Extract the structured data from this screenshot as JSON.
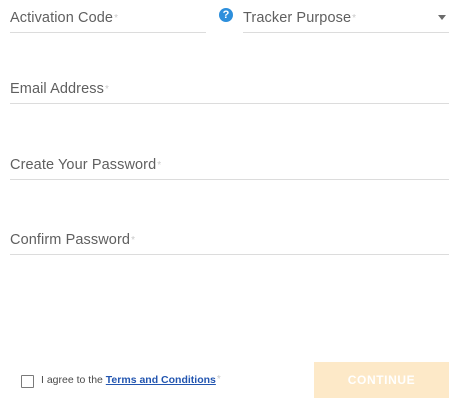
{
  "form": {
    "activation_code": {
      "placeholder": "Activation Code",
      "required_mark": "*"
    },
    "tracker_purpose": {
      "placeholder": "Tracker Purpose",
      "required_mark": "*"
    },
    "email": {
      "placeholder": "Email Address",
      "required_mark": "*"
    },
    "password": {
      "placeholder": "Create Your Password",
      "required_mark": "*"
    },
    "confirm_password": {
      "placeholder": "Confirm Password",
      "required_mark": "*"
    },
    "help_icon_glyph": "?",
    "agree_prefix": "I agree to the ",
    "terms_link": "Terms and Conditions",
    "agree_required_mark": "*",
    "continue_label": "CONTINUE",
    "agree_checked": false
  },
  "icons": {
    "help": "question-circle-icon",
    "dropdown": "caret-down-icon"
  },
  "colors": {
    "help_icon": "#2d8fdc",
    "link": "#2255b0",
    "continue_bg_disabled": "#fde9c8",
    "underline": "#dcdcdc"
  }
}
